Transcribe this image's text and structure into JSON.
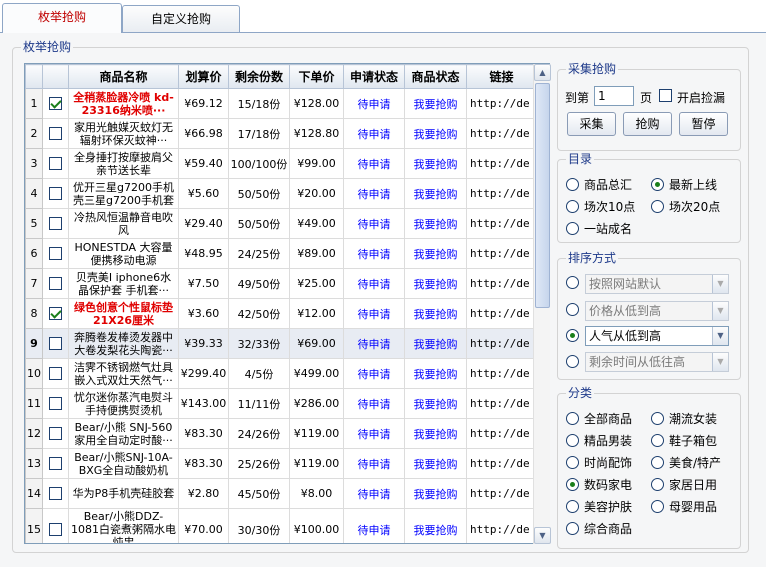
{
  "tabs": [
    {
      "label": "枚举抢购",
      "active": true
    },
    {
      "label": "自定义抢购",
      "active": false
    }
  ],
  "main_group_title": "枚举抢购",
  "table": {
    "headers": [
      "商品名称",
      "划算价",
      "剩余份数",
      "下单价",
      "申请状态",
      "商品状态",
      "链接"
    ],
    "rows": [
      {
        "num": "1",
        "checked": true,
        "name": "全稍蒸脸器冷喷 kd-23316纳米喷···",
        "red": true,
        "price": "¥69.12",
        "remaining": "15/18份",
        "order_price": "¥128.00",
        "apply": "待申请",
        "status": "我要抢购",
        "url": "http://de"
      },
      {
        "num": "2",
        "checked": false,
        "name": "家用光触媒灭蚊灯无辐射环保灭蚊神···",
        "red": false,
        "price": "¥66.98",
        "remaining": "17/18份",
        "order_price": "¥128.80",
        "apply": "待申请",
        "status": "我要抢购",
        "url": "http://de"
      },
      {
        "num": "3",
        "checked": false,
        "name": "全身捶打按摩披肩父亲节送长辈",
        "red": false,
        "price": "¥59.40",
        "remaining": "100/100份",
        "order_price": "¥99.00",
        "apply": "待申请",
        "status": "我要抢购",
        "url": "http://de"
      },
      {
        "num": "4",
        "checked": false,
        "name": "优开三星g7200手机壳三星g7200手机套",
        "red": false,
        "price": "¥5.60",
        "remaining": "50/50份",
        "order_price": "¥20.00",
        "apply": "待申请",
        "status": "我要抢购",
        "url": "http://de"
      },
      {
        "num": "5",
        "checked": false,
        "name": "冷热风恒温静音电吹风",
        "red": false,
        "price": "¥29.40",
        "remaining": "50/50份",
        "order_price": "¥49.00",
        "apply": "待申请",
        "status": "我要抢购",
        "url": "http://de"
      },
      {
        "num": "6",
        "checked": false,
        "name": "HONESTDA 大容量便携移动电源",
        "red": false,
        "price": "¥48.95",
        "remaining": "24/25份",
        "order_price": "¥89.00",
        "apply": "待申请",
        "status": "我要抢购",
        "url": "http://de"
      },
      {
        "num": "7",
        "checked": false,
        "name": "贝壳美I iphone6水晶保护套 手机套···",
        "red": false,
        "price": "¥7.50",
        "remaining": "49/50份",
        "order_price": "¥25.00",
        "apply": "待申请",
        "status": "我要抢购",
        "url": "http://de"
      },
      {
        "num": "8",
        "checked": true,
        "name": "绿色创意个性鼠标垫21X26厘米",
        "red": true,
        "price": "¥3.60",
        "remaining": "42/50份",
        "order_price": "¥12.00",
        "apply": "待申请",
        "status": "我要抢购",
        "url": "http://de"
      },
      {
        "num": "9",
        "checked": false,
        "name": "奔腾卷发棒烫发器中大卷发梨花头陶瓷···",
        "red": false,
        "price": "¥39.33",
        "remaining": "32/33份",
        "order_price": "¥69.00",
        "apply": "待申请",
        "status": "我要抢购",
        "url": "http://de"
      },
      {
        "num": "10",
        "checked": false,
        "name": "洁霁不锈钢燃气灶具嵌入式双灶天然气···",
        "red": false,
        "price": "¥299.40",
        "remaining": "4/5份",
        "order_price": "¥499.00",
        "apply": "待申请",
        "status": "我要抢购",
        "url": "http://de"
      },
      {
        "num": "11",
        "checked": false,
        "name": "忧尔迷你蒸汽电熨斗手持便携熨烫机",
        "red": false,
        "price": "¥143.00",
        "remaining": "11/11份",
        "order_price": "¥286.00",
        "apply": "待申请",
        "status": "我要抢购",
        "url": "http://de"
      },
      {
        "num": "12",
        "checked": false,
        "name": "Bear/小熊 SNJ-560家用全自动定时酸···",
        "red": false,
        "price": "¥83.30",
        "remaining": "24/26份",
        "order_price": "¥119.00",
        "apply": "待申请",
        "status": "我要抢购",
        "url": "http://de"
      },
      {
        "num": "13",
        "checked": false,
        "name": "Bear/小熊SNJ-10A-BXG全自动酸奶机",
        "red": false,
        "price": "¥83.30",
        "remaining": "25/26份",
        "order_price": "¥119.00",
        "apply": "待申请",
        "status": "我要抢购",
        "url": "http://de"
      },
      {
        "num": "14",
        "checked": false,
        "name": "华为P8手机壳硅胶套",
        "red": false,
        "price": "¥2.80",
        "remaining": "45/50份",
        "order_price": "¥8.00",
        "apply": "待申请",
        "status": "我要抢购",
        "url": "http://de"
      },
      {
        "num": "15",
        "checked": false,
        "name": "Bear/小熊DDZ-1081白瓷煮粥隔水电炖盅",
        "red": false,
        "price": "¥70.00",
        "remaining": "30/30份",
        "order_price": "¥100.00",
        "apply": "待申请",
        "status": "我要抢购",
        "url": "http://de"
      }
    ]
  },
  "collect": {
    "title": "采集抢购",
    "page_prefix": "到第",
    "page_value": "1",
    "page_suffix": "页",
    "auto_pickup_label": "开启捡漏",
    "auto_pickup_checked": false,
    "buttons": [
      "采集",
      "抢购",
      "暂停"
    ]
  },
  "catalog": {
    "title": "目录",
    "options": [
      {
        "label": "商品总汇",
        "selected": false
      },
      {
        "label": "最新上线",
        "selected": true
      },
      {
        "label": "场次10点",
        "selected": false
      },
      {
        "label": "场次20点",
        "selected": false
      },
      {
        "label": "一站成名",
        "selected": false
      }
    ]
  },
  "sort": {
    "title": "排序方式",
    "options": [
      {
        "label": "按照网站默认",
        "selected": false
      },
      {
        "label": "价格从低到高",
        "selected": false
      },
      {
        "label": "人气从低到高",
        "selected": true
      },
      {
        "label": "剩余时间从低往高",
        "selected": false
      }
    ]
  },
  "category": {
    "title": "分类",
    "options": [
      {
        "label": "全部商品",
        "selected": false
      },
      {
        "label": "潮流女装",
        "selected": false
      },
      {
        "label": "精品男装",
        "selected": false
      },
      {
        "label": "鞋子箱包",
        "selected": false
      },
      {
        "label": "时尚配饰",
        "selected": false
      },
      {
        "label": "美食/特产",
        "selected": false
      },
      {
        "label": "数码家电",
        "selected": true
      },
      {
        "label": "家居日用",
        "selected": false
      },
      {
        "label": "美容护肤",
        "selected": false
      },
      {
        "label": "母婴用品",
        "selected": false
      },
      {
        "label": "综合商品",
        "selected": false
      }
    ]
  },
  "colors": {
    "accent_red": "#e00000",
    "link_blue": "#0000ff",
    "check_green": "#1a7f1a"
  }
}
